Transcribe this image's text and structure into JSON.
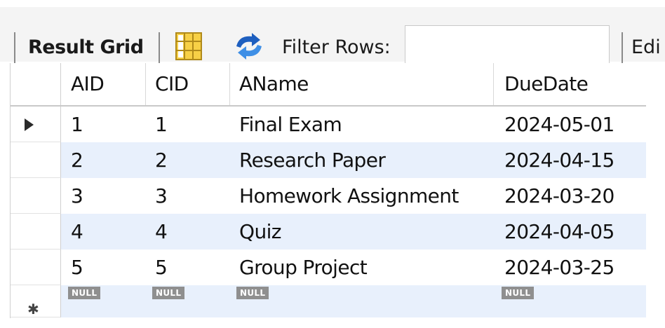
{
  "toolbar": {
    "result_grid_label": "Result Grid",
    "filter_rows_label": "Filter Rows:",
    "filter_value": "",
    "edit_label": "Edi",
    "icons": [
      "form-editor-icon",
      "refresh-icon"
    ],
    "accent_color": "#1e5fbf"
  },
  "grid": {
    "columns": [
      "AID",
      "CID",
      "AName",
      "DueDate"
    ],
    "rows": [
      [
        "1",
        "1",
        "Final Exam",
        "2024-05-01"
      ],
      [
        "2",
        "2",
        "Research Paper",
        "2024-04-15"
      ],
      [
        "3",
        "3",
        "Homework Assignment",
        "2024-03-20"
      ],
      [
        "4",
        "4",
        "Quiz",
        "2024-04-05"
      ],
      [
        "5",
        "5",
        "Group Project",
        "2024-03-25"
      ]
    ],
    "new_row": [
      "NULL",
      "NULL",
      "NULL",
      "NULL"
    ],
    "current_row_marker": "arrow-right-icon",
    "new_row_marker": "asterisk-icon",
    "alt_row_color": "#e8f0fc"
  }
}
